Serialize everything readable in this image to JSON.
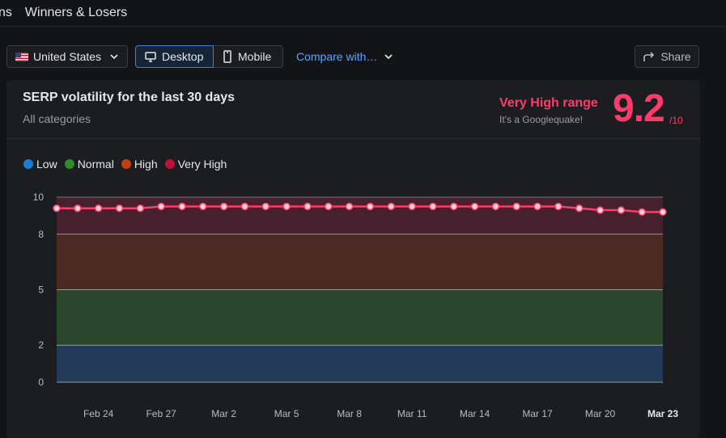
{
  "nav": {
    "tabs": [
      "ns",
      "Winners & Losers"
    ]
  },
  "controls": {
    "country": "United States",
    "devices": [
      "Desktop",
      "Mobile"
    ],
    "active_device": "Desktop",
    "compare_label": "Compare with…",
    "share_label": "Share"
  },
  "card": {
    "title": "SERP volatility for the last 30 days",
    "subtitle": "All categories",
    "range_label": "Very High range",
    "range_note": "It's a Googlequake!",
    "score": "9.2",
    "score_max": "/10"
  },
  "colors": {
    "low": "#1a7fd4",
    "normal": "#2e8b2e",
    "high": "#c0400f",
    "very_high": "#c0103a",
    "line": "#ff3b6b"
  },
  "chart_data": {
    "type": "line",
    "legend": [
      "Low",
      "Normal",
      "High",
      "Very High"
    ],
    "y_ticks": [
      0,
      2,
      5,
      8,
      10
    ],
    "ylim": [
      0,
      10
    ],
    "bands": [
      {
        "name": "Low",
        "from": 0,
        "to": 2,
        "fill": "#223a57"
      },
      {
        "name": "Normal",
        "from": 2,
        "to": 5,
        "fill": "#2b452c"
      },
      {
        "name": "High",
        "from": 5,
        "to": 8,
        "fill": "#4a2a22"
      },
      {
        "name": "Very High",
        "from": 8,
        "to": 10,
        "fill": "#47202d"
      }
    ],
    "x_tick_labels": [
      "Feb 24",
      "Feb 27",
      "Mar 2",
      "Mar 5",
      "Mar 8",
      "Mar 11",
      "Mar 14",
      "Mar 17",
      "Mar 20",
      "Mar 23"
    ],
    "x": [
      "Feb 22",
      "Feb 23",
      "Feb 24",
      "Feb 25",
      "Feb 26",
      "Feb 27",
      "Feb 28",
      "Mar 1",
      "Mar 2",
      "Mar 3",
      "Mar 4",
      "Mar 5",
      "Mar 6",
      "Mar 7",
      "Mar 8",
      "Mar 9",
      "Mar 10",
      "Mar 11",
      "Mar 12",
      "Mar 13",
      "Mar 14",
      "Mar 15",
      "Mar 16",
      "Mar 17",
      "Mar 18",
      "Mar 19",
      "Mar 20",
      "Mar 21",
      "Mar 22",
      "Mar 23"
    ],
    "series": [
      {
        "values": [
          9.4,
          9.4,
          9.4,
          9.4,
          9.4,
          9.5,
          9.5,
          9.5,
          9.5,
          9.5,
          9.5,
          9.5,
          9.5,
          9.5,
          9.5,
          9.5,
          9.5,
          9.5,
          9.5,
          9.5,
          9.5,
          9.5,
          9.5,
          9.5,
          9.5,
          9.4,
          9.3,
          9.3,
          9.2,
          9.2
        ]
      }
    ]
  }
}
